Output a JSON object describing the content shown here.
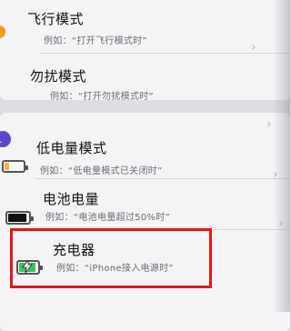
{
  "settings_list": {
    "rows": [
      {
        "title": "飞行模式",
        "subtitle": "例如：“打开飞行模式时”"
      },
      {
        "title": "勿扰模式",
        "subtitle": "例如：“打开勿扰模式时”"
      },
      {
        "title": "低电量模式",
        "subtitle": "例如：“低电量模式已关闭时”"
      },
      {
        "title": "电池电量",
        "subtitle": "例如：“电池电量超过50%时”"
      },
      {
        "title": "充电器",
        "subtitle": "例如：“iPhone接入电源时”"
      }
    ]
  },
  "icons": {
    "airplane": "airplane-mode-icon",
    "do_not_disturb": "moon-icon",
    "low_power": "low-power-battery-icon",
    "battery_level": "battery-level-icon",
    "charger": "charging-battery-icon"
  },
  "colors": {
    "airplane_orange": "#f39a1f",
    "dnd_purple": "#5a48c9",
    "low_power_yellow": "#f2b53a",
    "battery_black": "#111111",
    "charging_green": "#35c759",
    "highlight_red": "#f20d16"
  }
}
